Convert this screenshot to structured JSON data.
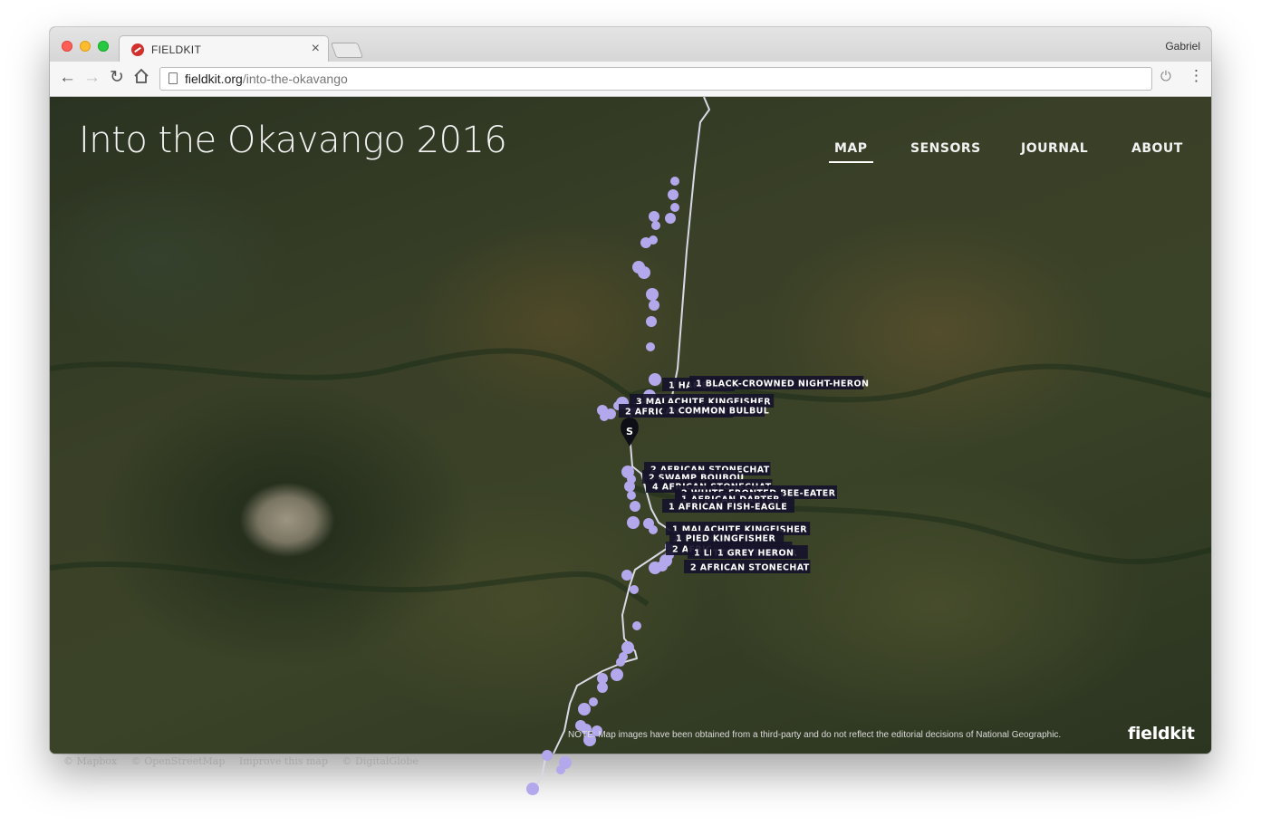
{
  "browser": {
    "tab_title": "FIELDKIT",
    "tab_close": "×",
    "profile_name": "Gabriel",
    "url_host": "fieldkit.org",
    "url_path": "/into-the-okavango",
    "icons": {
      "back": "arrow-left-icon",
      "forward": "arrow-right-icon",
      "reload": "reload-icon",
      "home": "home-icon",
      "page": "page-icon",
      "extension": "power-icon",
      "menu": "kebab-menu-icon"
    }
  },
  "site": {
    "title": "Into the Okavango 2016",
    "nav": [
      {
        "label": "MAP",
        "active": true
      },
      {
        "label": "SENSORS",
        "active": false
      },
      {
        "label": "JOURNAL",
        "active": false
      },
      {
        "label": "ABOUT",
        "active": false
      }
    ],
    "note": "NOTE: Map images have been obtained from a third-party and do not reflect the editorial decisions of National Geographic.",
    "logo": "fieldkit"
  },
  "map": {
    "start_marker_label": "S",
    "sighting_labels": [
      "1 HAMERKOP",
      "1 BLACK-CROWNED NIGHT-HERON",
      "3 MALACHITE KINGFISHER",
      "2 AFRICAN FINFOOT",
      "1 COMMON BULBUL",
      "2 AFRICAN STONECHAT",
      "2 SWAMP BOUBOU",
      "4 AFRICAN STONECHAT",
      "2 WHITE-FRONTED BEE-EATER",
      "1 AFRICAN DARTER",
      "1 AFRICAN FISH-EAGLE",
      "1 MALACHITE KINGFISHER",
      "1 PIED KINGFISHER",
      "2 AFRICAN STONECHAT",
      "1 LITTLE BEE-EATER",
      "1 GREY HERON",
      "2 AFRICAN STONECHAT"
    ],
    "attribution": [
      "© Mapbox",
      "© OpenStreetMap",
      "Improve this map",
      "© DigitalGlobe"
    ],
    "colors": {
      "track": "#d9d9e6",
      "sighting": "#b3a8ec",
      "label_bg": "#16122a",
      "label_text": "#ffffff"
    }
  }
}
